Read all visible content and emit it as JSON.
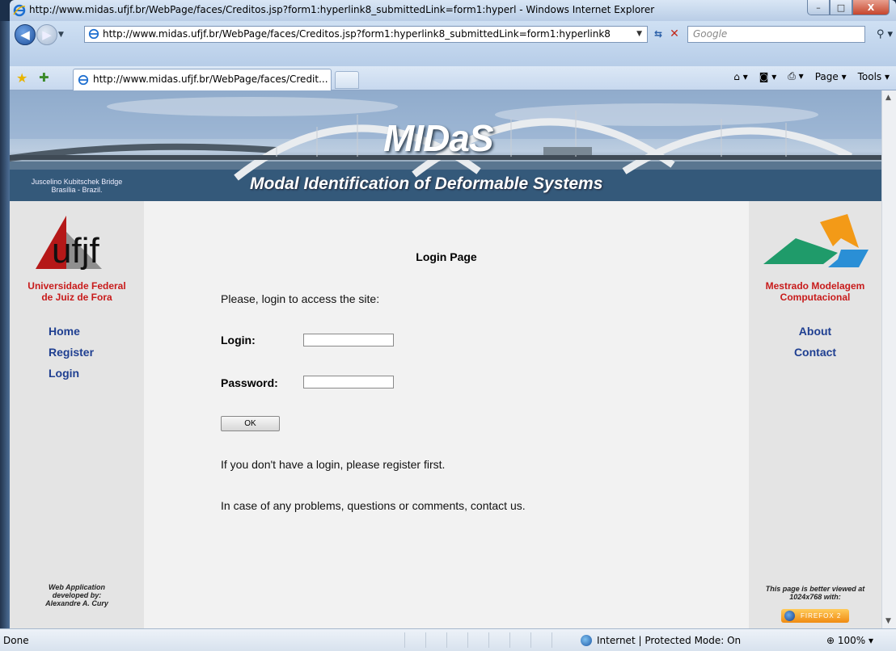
{
  "window": {
    "title": "http://www.midas.ufjf.br/WebPage/faces/Creditos.jsp?form1:hyperlink8_submittedLink=form1:hyperl - Windows Internet Explorer",
    "minimize": "–",
    "maximize": "□",
    "close": "X"
  },
  "address_bar": {
    "url": "http://www.midas.ufjf.br/WebPage/faces/Creditos.jsp?form1:hyperlink8_submittedLink=form1:hyperlink8",
    "search_placeholder": "Google"
  },
  "tabs": [
    {
      "label": "http://www.midas.ufjf.br/WebPage/faces/Credit..."
    }
  ],
  "command_bar": {
    "page": "Page ▾",
    "tools": "Tools ▾"
  },
  "banner": {
    "title": "MIDaS",
    "subtitle": "Modal Identification of Deformable Systems",
    "caption_line1": "Juscelino Kubitschek Bridge",
    "caption_line2": "Brasília - Brazil."
  },
  "left_sidebar": {
    "logo_text": "ufjf",
    "university_line1": "Universidade Federal",
    "university_line2": "de Juiz de Fora",
    "nav": [
      "Home",
      "Register",
      "Login"
    ],
    "credit_line1": "Web Application",
    "credit_line2": "developed by:",
    "credit_line3": "Alexandre A. Cury"
  },
  "right_sidebar": {
    "program_line1": "Mestrado Modelagem",
    "program_line2": "Computacional",
    "nav": [
      "About",
      "Contact"
    ],
    "note_line1": "This page is better viewed at",
    "note_line2": "1024x768 with:",
    "badge": "FIREFOX 2"
  },
  "main": {
    "heading": "Login Page",
    "intro": "Please, login to access the site:",
    "login_label": "Login:",
    "login_value": "",
    "password_label": "Password:",
    "password_value": "",
    "ok_label": "OK",
    "register_note": "If you don't have a login, please register first.",
    "contact_note": "In case of any problems, questions or comments, contact us."
  },
  "status_bar": {
    "status": "Done",
    "zone": "Internet | Protected Mode: On",
    "zoom": "100%"
  },
  "colors": {
    "accent_red": "#c81b1b",
    "link_blue": "#1f3f91",
    "sidebar_bg": "#e4e4e4",
    "main_bg": "#f2f2f2"
  }
}
